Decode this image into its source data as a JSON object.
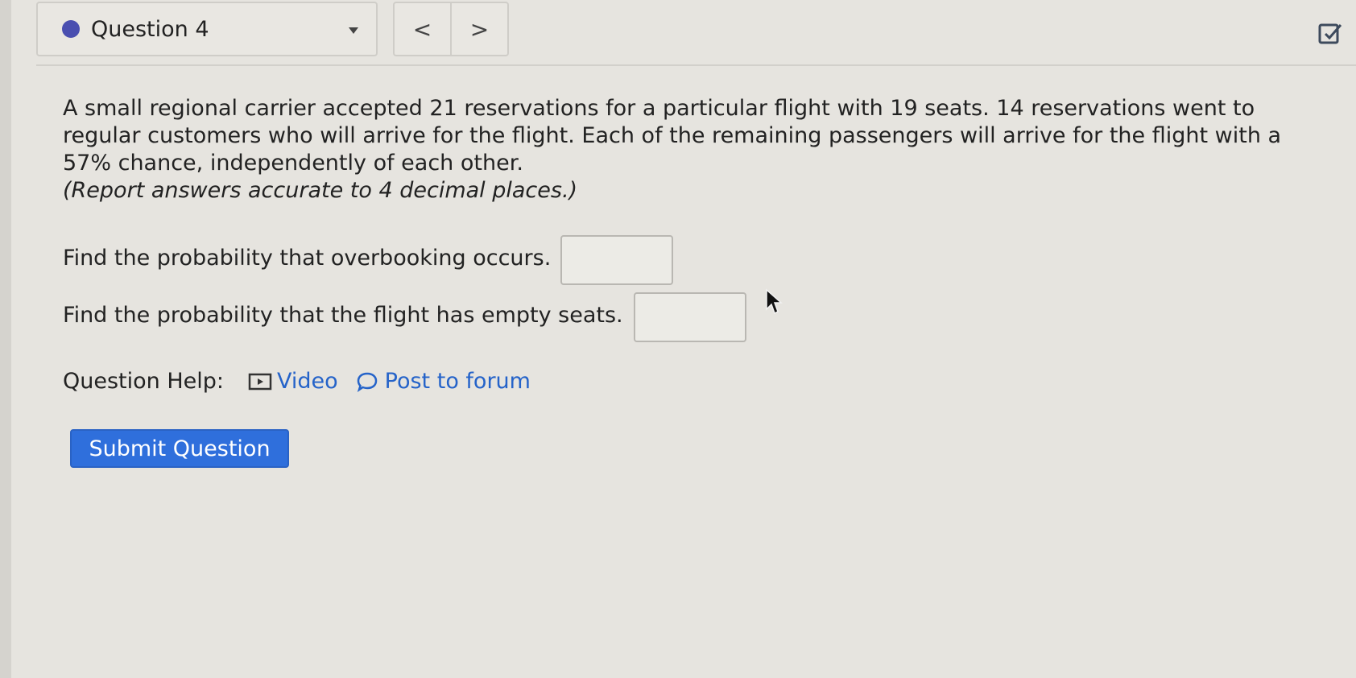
{
  "header": {
    "question_label": "Question 4",
    "prev_label": "<",
    "next_label": ">"
  },
  "problem": {
    "text": "A small regional carrier accepted 21 reservations for a particular flight with 19 seats. 14 reservations went to regular customers who will arrive for the flight. Each of the remaining passengers will arrive for the flight with a 57% chance, independently of each other.",
    "note": "(Report answers accurate to 4 decimal places.)"
  },
  "parts": [
    {
      "prompt": "Find the probability that overbooking occurs.",
      "answer": ""
    },
    {
      "prompt": "Find the probability that the flight has empty seats.",
      "answer": ""
    }
  ],
  "help": {
    "label": "Question Help:",
    "video_label": "Video",
    "forum_label": "Post to forum"
  },
  "submit_label": "Submit Question",
  "colors": {
    "status_dot": "#4a4fb0",
    "link": "#2563c9",
    "submit_bg": "#2f6fdc"
  }
}
